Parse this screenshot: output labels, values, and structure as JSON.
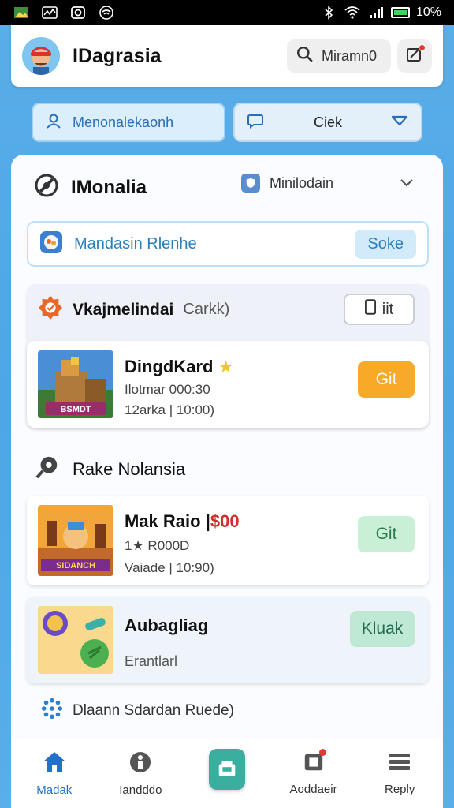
{
  "status_bar": {
    "battery": "10%",
    "icons": [
      "gallery-icon",
      "activity-icon",
      "camera-icon",
      "wifi-calling-icon",
      "bluetooth-icon",
      "wifi-icon",
      "signal-icon",
      "battery-icon"
    ]
  },
  "header": {
    "app_title": "IDagrasia",
    "search_label": "Miramn0",
    "has_notification": true
  },
  "chips": {
    "primary_label": "Menonalekaonh",
    "secondary_label": "Ciek"
  },
  "section_main": {
    "title": "IMonalia",
    "filter_label": "Minilodain"
  },
  "banner": {
    "text": "Mandasin Rlenhe",
    "button_label": "Soke"
  },
  "group": {
    "title": "Vkajmelindai",
    "subtitle": "Carkk)",
    "button_label": "iit"
  },
  "items": [
    {
      "title": "DingdKard",
      "line1": "Ilotmar 000:30",
      "line2": "12arka | 10:00)",
      "button_label": "Git",
      "thumb_label": "BSMDT",
      "star": "★"
    },
    {
      "title_prefix": "Mak Raio |",
      "price": "$00",
      "line1": "1★ R000D",
      "line2": "Vaiade | 10:90)",
      "button_label": "Git",
      "thumb_label": "SIDANCH"
    },
    {
      "title": "Aubagliag",
      "line1": "Erantlarl",
      "button_label": "Kluak"
    }
  ],
  "section_two": {
    "title": "Rake Nolansia"
  },
  "footer_hint": "Dlaann Sdardan Ruede)",
  "bottom_nav": [
    {
      "label": "Madak",
      "icon": "home-icon",
      "active": true
    },
    {
      "label": "Iandddo",
      "icon": "info-icon",
      "active": false
    },
    {
      "label": "",
      "icon": "store-icon",
      "active": false
    },
    {
      "label": "Aoddaeir",
      "icon": "device-icon",
      "active": false,
      "badge": true
    },
    {
      "label": "Reply",
      "icon": "menu-icon",
      "active": false
    }
  ],
  "colors": {
    "background": "#4da6e6",
    "accent_blue": "#1f72c9",
    "get_orange": "#f7a928",
    "get_green": "#c9f0d6",
    "price_red": "#d32f2f"
  }
}
